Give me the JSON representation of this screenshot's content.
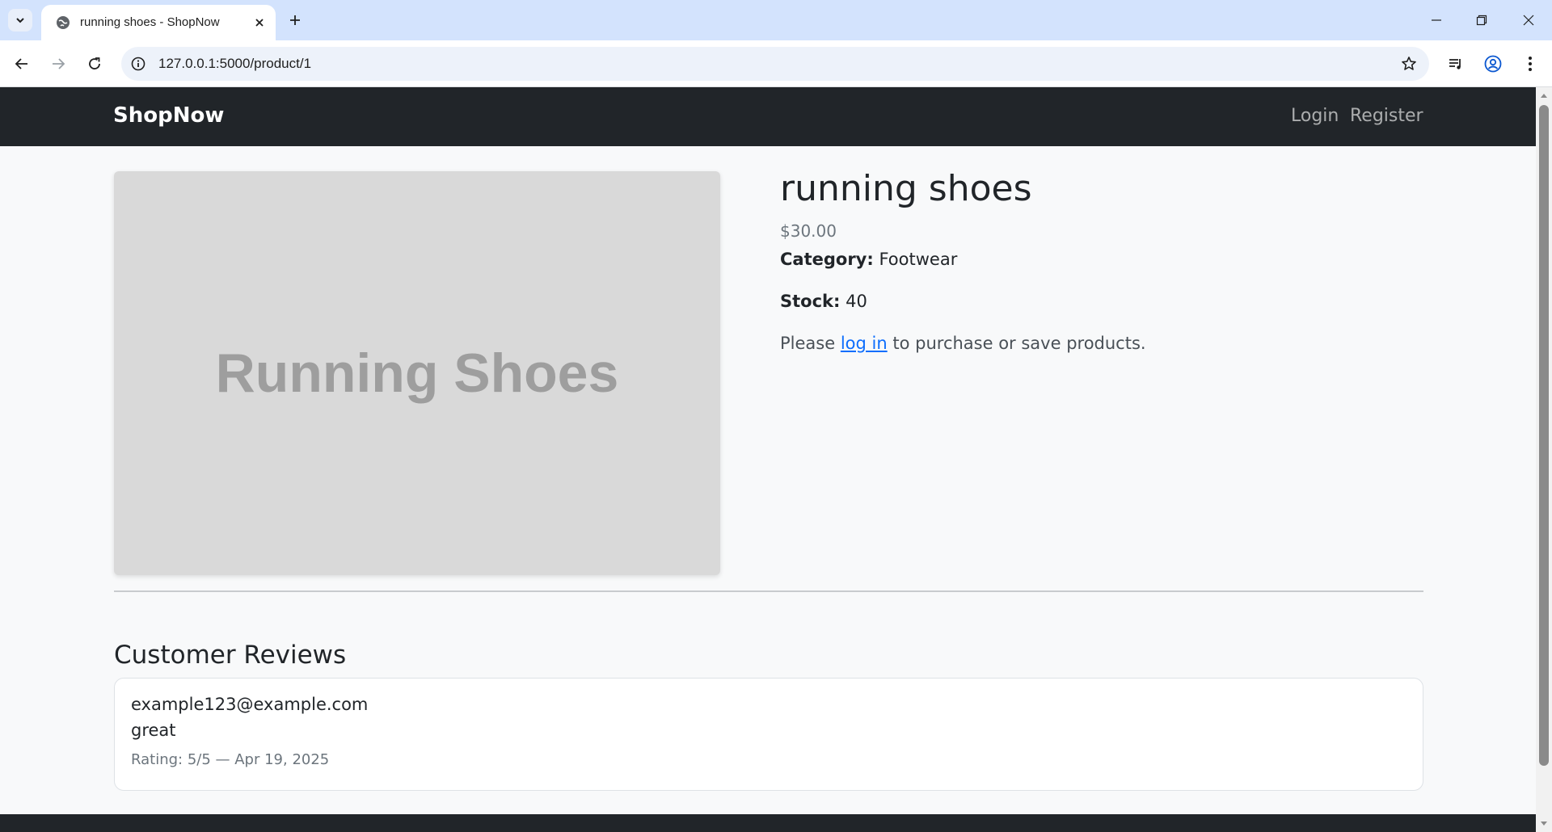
{
  "browser": {
    "tab_title": "running shoes - ShopNow",
    "url": "127.0.0.1:5000/product/1"
  },
  "navbar": {
    "brand": "ShopNow",
    "links": [
      "Login",
      "Register"
    ]
  },
  "product": {
    "image_text": "Running Shoes",
    "name": "running shoes",
    "price": "$30.00",
    "category_label": "Category:",
    "category": "Footwear",
    "stock_label": "Stock:",
    "stock": "40",
    "login_prefix": "Please",
    "login_link": "log in",
    "login_suffix": "to purchase or save products."
  },
  "reviews": {
    "heading": "Customer Reviews",
    "items": [
      {
        "author": "example123@example.com",
        "text": "great",
        "meta": "Rating: 5/5 — Apr 19, 2025"
      }
    ]
  },
  "colors": {
    "navbar_bg": "#212529",
    "page_bg": "#f8f9fa",
    "link": "#0d6efd",
    "chrome_tabstrip": "#d3e3fd"
  },
  "icons": [
    "tab-search-icon",
    "globe-icon",
    "close-icon",
    "plus-icon",
    "minimize-icon",
    "restore-icon",
    "window-close-icon",
    "back-arrow-icon",
    "forward-arrow-icon",
    "reload-icon",
    "info-icon",
    "star-icon",
    "media-control-icon",
    "profile-icon",
    "more-vert-icon"
  ]
}
